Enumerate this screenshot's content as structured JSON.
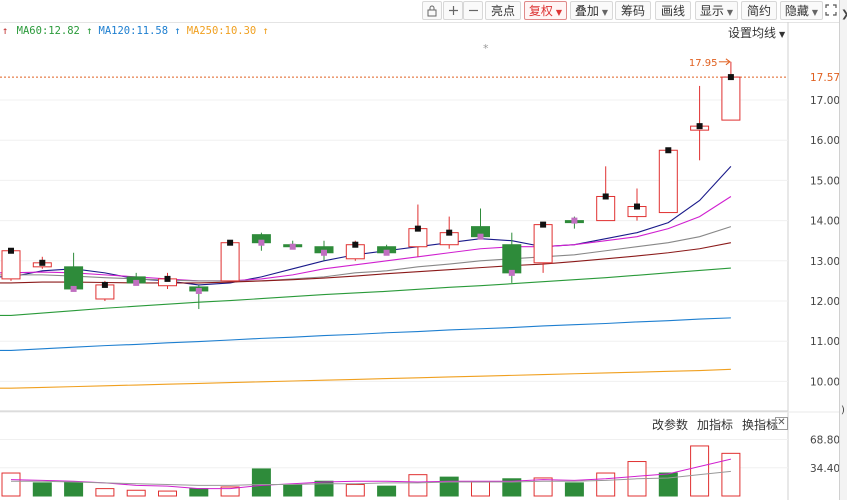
{
  "toolbar": {
    "icons": [
      "lock-icon",
      "plus-icon",
      "minus-icon"
    ],
    "buttons": [
      {
        "label": "亮点",
        "active": false,
        "dropdown": false
      },
      {
        "label": "复权",
        "active": true,
        "dropdown": true
      },
      {
        "label": "叠加",
        "active": false,
        "dropdown": true
      },
      {
        "label": "筹码",
        "active": false,
        "dropdown": false
      },
      {
        "label": "画线",
        "active": false,
        "dropdown": false
      },
      {
        "label": "显示",
        "active": false,
        "dropdown": true
      },
      {
        "label": "简约",
        "active": false,
        "dropdown": false
      },
      {
        "label": "隐藏",
        "active": false,
        "dropdown": true
      }
    ],
    "fullscreen_icon": "expand-icon"
  },
  "ma_legend": [
    {
      "label": "MA60:12.82",
      "arrow": "↑",
      "color": "#2a9a3a"
    },
    {
      "label": "MA120:11.58",
      "arrow": "↑",
      "color": "#1e7fd0"
    },
    {
      "label": "MA250:10.30",
      "arrow": "↑",
      "color": "#f0a020"
    }
  ],
  "ma_legend_lead_arrow": {
    "arrow": "↑",
    "color": "#c03030"
  },
  "settings_label": "设置均线",
  "price_labels": [
    "17.00",
    "16.00",
    "15.00",
    "14.00",
    "13.00",
    "12.00",
    "11.00",
    "10.00"
  ],
  "current_price": "17.57",
  "high_marker": "17.95",
  "volume_labels": [
    "68.80",
    "34.40"
  ],
  "volume_toolbar": [
    "改参数",
    "加指标",
    "换指标"
  ],
  "colors": {
    "up": "#e03030",
    "down": "#2e8b3a",
    "ma_blue": "#1e7fd0",
    "ma_green": "#2a9a3a",
    "ma_orange": "#f0a020",
    "ma_darkred": "#8b1a1a",
    "ma_gray": "#888888",
    "ma_magenta": "#d020d0",
    "ma_navy": "#1a1a8a",
    "price_line": "#e06020"
  },
  "chart_data": {
    "type": "candlestick",
    "ylim": [
      9.5,
      18.5
    ],
    "candles": [
      {
        "o": 12.55,
        "h": 13.3,
        "l": 12.5,
        "c": 13.25,
        "dir": "up"
      },
      {
        "o": 12.85,
        "h": 13.1,
        "l": 12.8,
        "c": 12.95,
        "dir": "up"
      },
      {
        "o": 12.85,
        "h": 13.2,
        "l": 12.25,
        "c": 12.3,
        "dir": "down"
      },
      {
        "o": 12.05,
        "h": 12.5,
        "l": 12.0,
        "c": 12.4,
        "dir": "up"
      },
      {
        "o": 12.6,
        "h": 12.7,
        "l": 12.4,
        "c": 12.45,
        "dir": "down"
      },
      {
        "o": 12.38,
        "h": 12.7,
        "l": 12.3,
        "c": 12.55,
        "dir": "up"
      },
      {
        "o": 12.35,
        "h": 12.4,
        "l": 11.8,
        "c": 12.25,
        "dir": "down"
      },
      {
        "o": 12.5,
        "h": 13.5,
        "l": 12.5,
        "c": 13.45,
        "dir": "up"
      },
      {
        "o": 13.65,
        "h": 13.7,
        "l": 13.25,
        "c": 13.45,
        "dir": "down"
      },
      {
        "o": 13.4,
        "h": 13.5,
        "l": 13.3,
        "c": 13.35,
        "dir": "down"
      },
      {
        "o": 13.35,
        "h": 13.5,
        "l": 13.0,
        "c": 13.2,
        "dir": "down"
      },
      {
        "o": 13.05,
        "h": 13.5,
        "l": 13.0,
        "c": 13.4,
        "dir": "up"
      },
      {
        "o": 13.35,
        "h": 13.4,
        "l": 13.15,
        "c": 13.2,
        "dir": "down"
      },
      {
        "o": 13.35,
        "h": 14.4,
        "l": 13.1,
        "c": 13.8,
        "dir": "up"
      },
      {
        "o": 13.4,
        "h": 14.1,
        "l": 13.3,
        "c": 13.7,
        "dir": "up"
      },
      {
        "o": 13.85,
        "h": 14.3,
        "l": 13.55,
        "c": 13.6,
        "dir": "down"
      },
      {
        "o": 13.4,
        "h": 13.7,
        "l": 12.45,
        "c": 12.7,
        "dir": "down"
      },
      {
        "o": 12.95,
        "h": 13.95,
        "l": 12.7,
        "c": 13.9,
        "dir": "up"
      },
      {
        "o": 13.95,
        "h": 14.1,
        "l": 13.8,
        "c": 14.0,
        "dir": "down"
      },
      {
        "o": 14.0,
        "h": 15.35,
        "l": 14.0,
        "c": 14.6,
        "dir": "up"
      },
      {
        "o": 14.1,
        "h": 14.8,
        "l": 14.0,
        "c": 14.35,
        "dir": "up"
      },
      {
        "o": 14.2,
        "h": 15.75,
        "l": 14.2,
        "c": 15.75,
        "dir": "up"
      },
      {
        "o": 16.25,
        "h": 17.35,
        "l": 15.5,
        "c": 16.35,
        "dir": "up"
      },
      {
        "o": 16.5,
        "h": 17.95,
        "l": 16.5,
        "c": 17.57,
        "dir": "up"
      }
    ],
    "ma_lines": [
      {
        "name": "MA5",
        "color": "#1a1a8a",
        "values": [
          12.6,
          12.75,
          12.8,
          12.7,
          12.55,
          12.5,
          12.4,
          12.45,
          12.6,
          12.8,
          13.0,
          13.15,
          13.25,
          13.35,
          13.45,
          13.55,
          13.5,
          13.35,
          13.4,
          13.55,
          13.7,
          13.95,
          14.5,
          15.35
        ]
      },
      {
        "name": "MA10",
        "color": "#d020d0",
        "values": [
          12.7,
          12.72,
          12.7,
          12.65,
          12.6,
          12.55,
          12.5,
          12.5,
          12.55,
          12.65,
          12.8,
          12.9,
          13.0,
          13.1,
          13.2,
          13.3,
          13.35,
          13.35,
          13.4,
          13.5,
          13.6,
          13.8,
          14.1,
          14.6
        ]
      },
      {
        "name": "MA20",
        "color": "#888888",
        "values": [
          12.65,
          12.65,
          12.62,
          12.58,
          12.55,
          12.52,
          12.5,
          12.5,
          12.5,
          12.55,
          12.6,
          12.7,
          12.75,
          12.85,
          12.92,
          13.0,
          13.05,
          13.1,
          13.15,
          13.25,
          13.35,
          13.45,
          13.6,
          13.85
        ]
      },
      {
        "name": "MA30",
        "color": "#8b1a1a",
        "values": [
          12.45,
          12.47,
          12.47,
          12.46,
          12.45,
          12.45,
          12.45,
          12.47,
          12.5,
          12.53,
          12.57,
          12.62,
          12.68,
          12.73,
          12.78,
          12.83,
          12.88,
          12.92,
          12.98,
          13.05,
          13.12,
          13.2,
          13.3,
          13.45
        ]
      },
      {
        "name": "MA60",
        "color": "#2a9a3a",
        "values": [
          11.64,
          11.7,
          11.76,
          11.82,
          11.87,
          11.92,
          11.97,
          12.01,
          12.06,
          12.11,
          12.16,
          12.2,
          12.24,
          12.29,
          12.34,
          12.38,
          12.43,
          12.48,
          12.53,
          12.58,
          12.64,
          12.7,
          12.76,
          12.82
        ]
      },
      {
        "name": "MA120",
        "color": "#1e7fd0",
        "values": [
          10.77,
          10.81,
          10.85,
          10.89,
          10.92,
          10.96,
          10.99,
          11.03,
          11.07,
          11.1,
          11.14,
          11.17,
          11.21,
          11.24,
          11.28,
          11.31,
          11.34,
          11.38,
          11.41,
          11.44,
          11.48,
          11.51,
          11.55,
          11.58
        ]
      },
      {
        "name": "MA250",
        "color": "#f0a020",
        "values": [
          9.83,
          9.85,
          9.87,
          9.89,
          9.91,
          9.93,
          9.95,
          9.97,
          9.99,
          10.01,
          10.03,
          10.05,
          10.07,
          10.09,
          10.11,
          10.13,
          10.15,
          10.17,
          10.19,
          10.21,
          10.23,
          10.25,
          10.27,
          10.3
        ]
      }
    ],
    "volume": {
      "ylim": [
        0,
        78
      ],
      "values": [
        28,
        16,
        17,
        9,
        7,
        6,
        9,
        11,
        33,
        14,
        18,
        14,
        12,
        26,
        23,
        17,
        21,
        22,
        16,
        28,
        42,
        28,
        61,
        52
      ],
      "dirs": [
        "up",
        "down",
        "down",
        "up",
        "up",
        "up",
        "down",
        "up",
        "down",
        "down",
        "down",
        "up",
        "down",
        "up",
        "down",
        "up",
        "down",
        "up",
        "down",
        "up",
        "up",
        "down",
        "up",
        "up"
      ],
      "ma_lines": [
        {
          "color": "#d020d0",
          "values": [
            20,
            19,
            18,
            16,
            13,
            12,
            9,
            9,
            13,
            15,
            17,
            18,
            18,
            17,
            18,
            18,
            18,
            20,
            19,
            21,
            24,
            27,
            36,
            45
          ]
        },
        {
          "color": "#999999",
          "values": [
            18,
            18,
            17,
            16,
            15,
            14,
            13,
            13,
            14,
            14,
            15,
            15,
            16,
            16,
            17,
            17,
            17,
            18,
            18,
            19,
            21,
            22,
            26,
            30
          ]
        }
      ]
    }
  }
}
